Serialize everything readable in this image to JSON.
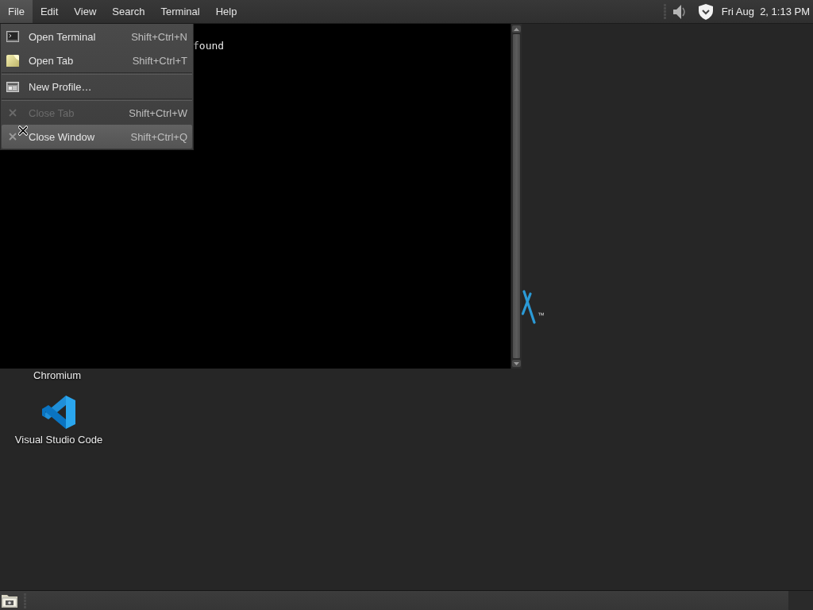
{
  "top_panel": {
    "menubar": [
      {
        "label": "File",
        "selected": true
      },
      {
        "label": "Edit",
        "selected": false
      },
      {
        "label": "View",
        "selected": false
      },
      {
        "label": "Search",
        "selected": false
      },
      {
        "label": "Terminal",
        "selected": false
      },
      {
        "label": "Help",
        "selected": false
      }
    ],
    "clock": "Fri Aug  2, 1:13 PM"
  },
  "file_menu": {
    "items": [
      {
        "kind": "item",
        "label": "Open Terminal",
        "shortcut": "Shift+Ctrl+N",
        "disabled": false,
        "selected": false
      },
      {
        "kind": "item",
        "label": "Open Tab",
        "shortcut": "Shift+Ctrl+T",
        "disabled": false,
        "selected": false
      },
      {
        "kind": "separator"
      },
      {
        "kind": "item",
        "label": "New Profile…",
        "disabled": false,
        "selected": false
      },
      {
        "kind": "separator"
      },
      {
        "kind": "item",
        "label": "Close Tab",
        "shortcut": "Shift+Ctrl+W",
        "disabled": true,
        "selected": false
      },
      {
        "kind": "item",
        "label": "Close Window",
        "shortcut": "Shift+Ctrl+Q",
        "disabled": false,
        "selected": true
      }
    ]
  },
  "terminal": {
    "lines": [
      "found"
    ]
  },
  "desktop": {
    "icons": [
      {
        "label": "Chromium"
      },
      {
        "label": "Visual Studio Code"
      }
    ],
    "logo": {
      "mark": "™"
    }
  }
}
